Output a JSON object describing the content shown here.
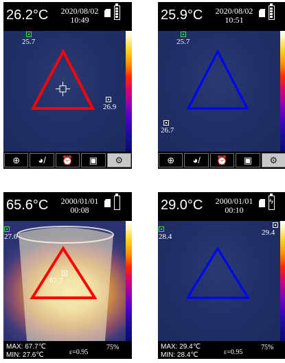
{
  "screens": [
    {
      "temp": "26.2°C",
      "date": "2020/08/02",
      "time": "10:49",
      "tags": [
        {
          "value": "25.7"
        },
        {
          "value": "26.9"
        }
      ],
      "triangle_color": "#ff0000",
      "toolbar": [
        {
          "icon": "crosshair-icon",
          "glyph": "⊕"
        },
        {
          "icon": "palette-icon",
          "glyph": "🎨/"
        },
        {
          "icon": "alarm-icon",
          "glyph": "⏰"
        },
        {
          "icon": "image-icon",
          "glyph": "▣"
        },
        {
          "icon": "gear-icon",
          "glyph": "⚙"
        }
      ]
    },
    {
      "temp": "25.9°C",
      "date": "2020/08/02",
      "time": "10:51",
      "tags": [
        {
          "value": "25.7"
        },
        {
          "value": "26.7"
        }
      ],
      "triangle_color": "#0000ff",
      "toolbar": [
        {
          "icon": "crosshair-icon",
          "glyph": "⊕"
        },
        {
          "icon": "palette-icon",
          "glyph": "🎨/"
        },
        {
          "icon": "alarm-icon",
          "glyph": "⏰"
        },
        {
          "icon": "image-icon",
          "glyph": "▣"
        },
        {
          "icon": "gear-icon",
          "glyph": "⚙"
        }
      ]
    },
    {
      "temp": "65.6°C",
      "date": "2000/01/01",
      "time": "00:08",
      "tags": [
        {
          "value": "27.6"
        },
        {
          "value": "67.7"
        }
      ],
      "triangle_color": "#ff0000",
      "max": "MAX: 67.7℃",
      "min": "MIN: 27.6℃",
      "emissivity": "ε=0.95",
      "percent": "75%"
    },
    {
      "temp": "29.0°C",
      "date": "2000/01/01",
      "time": "00:10",
      "tags": [
        {
          "value": "28.4"
        },
        {
          "value": "29.4"
        }
      ],
      "triangle_color": "#0000ff",
      "max": "MAX: 29.4℃",
      "min": "MIN: 28.4℃",
      "emissivity": "ε=0.95",
      "percent": "75%"
    }
  ]
}
